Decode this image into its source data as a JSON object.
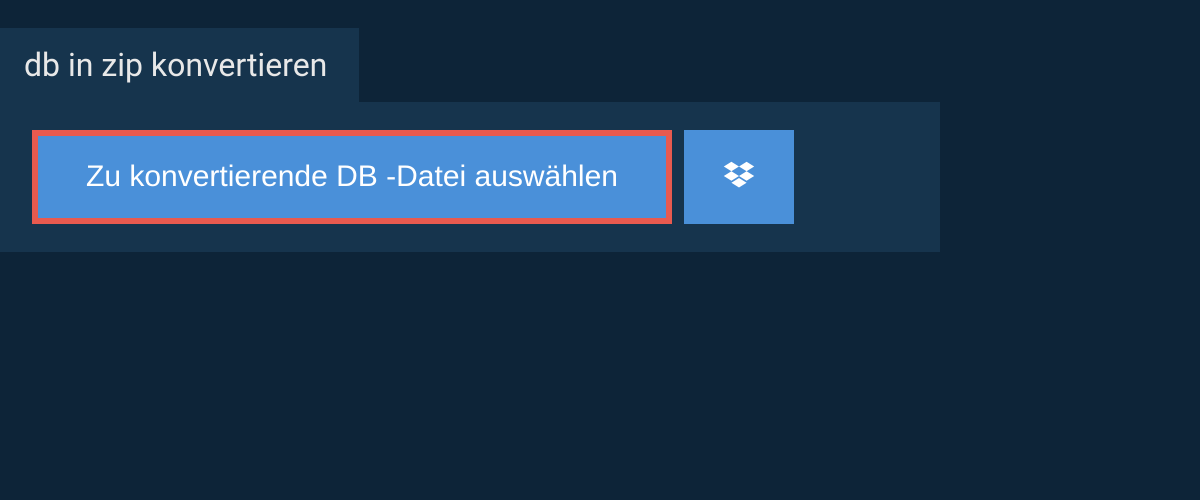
{
  "tab": {
    "title": "db in zip konvertieren"
  },
  "upload": {
    "select_file_label": "Zu konvertierende DB -Datei auswählen"
  }
}
